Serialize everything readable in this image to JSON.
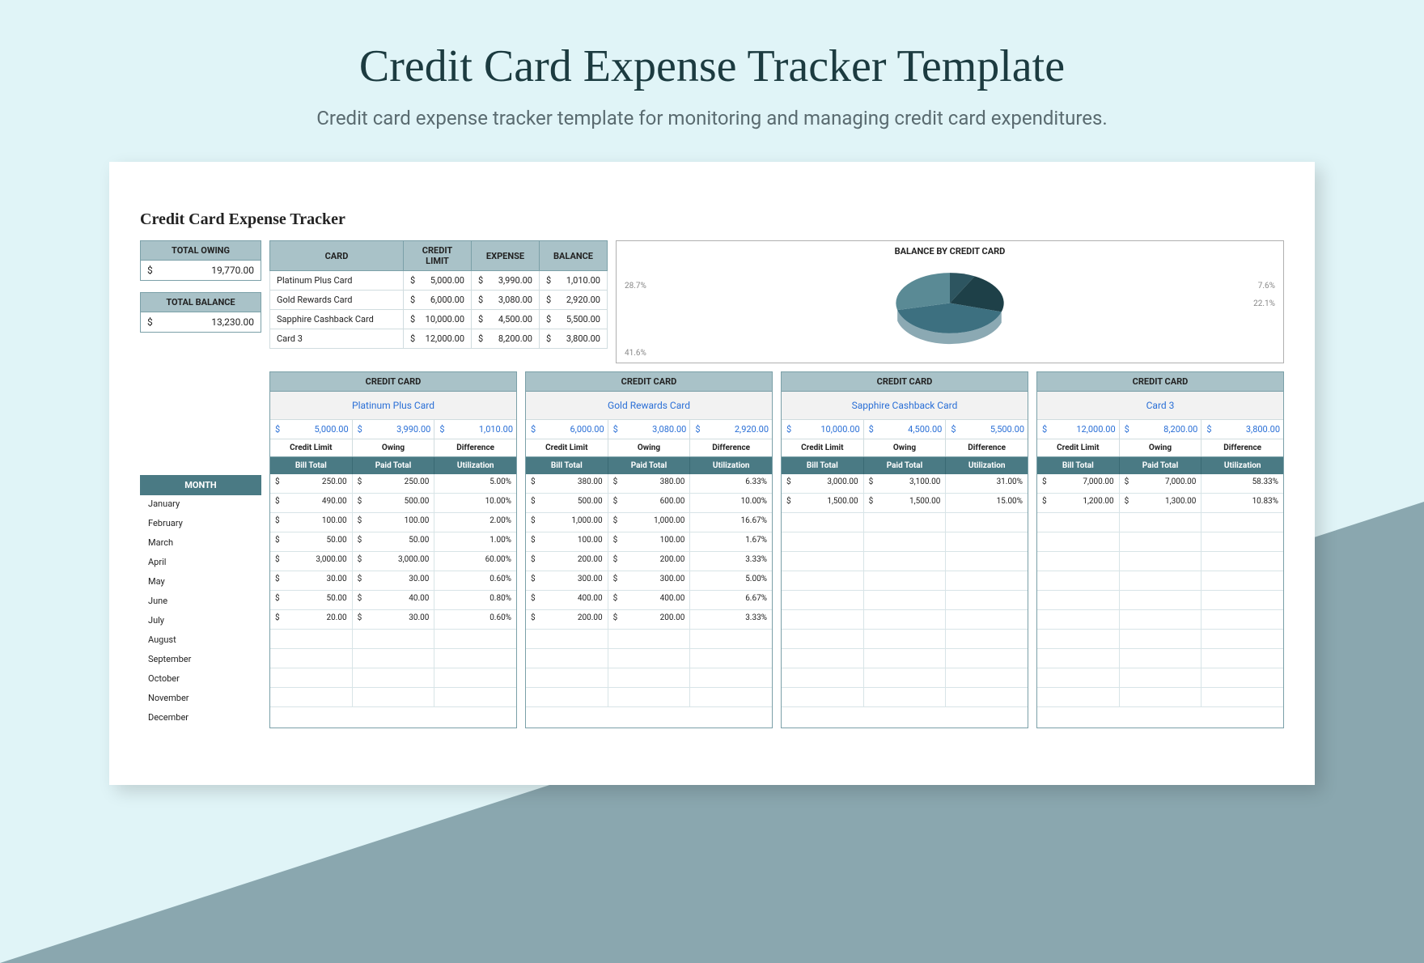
{
  "page": {
    "title": "Credit Card Expense Tracker Template",
    "subtitle": "Credit card expense tracker template for monitoring and managing credit card expenditures."
  },
  "sheet": {
    "title": "Credit Card Expense Tracker",
    "totals": {
      "owing_label": "TOTAL OWING",
      "owing_value": "19,770.00",
      "balance_label": "TOTAL BALANCE",
      "balance_value": "13,230.00"
    },
    "summary": {
      "headers": {
        "card": "CARD",
        "limit": "CREDIT LIMIT",
        "expense": "EXPENSE",
        "balance": "BALANCE"
      },
      "rows": [
        {
          "name": "Platinum Plus Card",
          "limit": "5,000.00",
          "expense": "3,990.00",
          "balance": "1,010.00"
        },
        {
          "name": "Gold Rewards Card",
          "limit": "6,000.00",
          "expense": "3,080.00",
          "balance": "2,920.00"
        },
        {
          "name": "Sapphire Cashback Card",
          "limit": "10,000.00",
          "expense": "4,500.00",
          "balance": "5,500.00"
        },
        {
          "name": "Card 3",
          "limit": "12,000.00",
          "expense": "8,200.00",
          "balance": "3,800.00"
        }
      ]
    },
    "chart_title": "BALANCE BY CREDIT CARD",
    "month_label": "MONTH",
    "months": [
      "January",
      "February",
      "March",
      "April",
      "May",
      "June",
      "July",
      "August",
      "September",
      "October",
      "November",
      "December"
    ],
    "card_header": "CREDIT CARD",
    "sublabels": {
      "limit": "Credit Limit",
      "owing": "Owing",
      "diff": "Difference"
    },
    "monthly_headers": {
      "bill": "Bill Total",
      "paid": "Paid Total",
      "util": "Utilization"
    },
    "cards": [
      {
        "name": "Platinum Plus Card",
        "limit": "5,000.00",
        "owing": "3,990.00",
        "diff": "1,010.00",
        "rows": [
          {
            "bill": "250.00",
            "paid": "250.00",
            "util": "5.00%"
          },
          {
            "bill": "490.00",
            "paid": "500.00",
            "util": "10.00%"
          },
          {
            "bill": "100.00",
            "paid": "100.00",
            "util": "2.00%"
          },
          {
            "bill": "50.00",
            "paid": "50.00",
            "util": "1.00%"
          },
          {
            "bill": "3,000.00",
            "paid": "3,000.00",
            "util": "60.00%"
          },
          {
            "bill": "30.00",
            "paid": "30.00",
            "util": "0.60%"
          },
          {
            "bill": "50.00",
            "paid": "40.00",
            "util": "0.80%"
          },
          {
            "bill": "20.00",
            "paid": "30.00",
            "util": "0.60%"
          },
          {},
          {},
          {},
          {}
        ]
      },
      {
        "name": "Gold Rewards Card",
        "limit": "6,000.00",
        "owing": "3,080.00",
        "diff": "2,920.00",
        "rows": [
          {
            "bill": "380.00",
            "paid": "380.00",
            "util": "6.33%"
          },
          {
            "bill": "500.00",
            "paid": "600.00",
            "util": "10.00%"
          },
          {
            "bill": "1,000.00",
            "paid": "1,000.00",
            "util": "16.67%"
          },
          {
            "bill": "100.00",
            "paid": "100.00",
            "util": "1.67%"
          },
          {
            "bill": "200.00",
            "paid": "200.00",
            "util": "3.33%"
          },
          {
            "bill": "300.00",
            "paid": "300.00",
            "util": "5.00%"
          },
          {
            "bill": "400.00",
            "paid": "400.00",
            "util": "6.67%"
          },
          {
            "bill": "200.00",
            "paid": "200.00",
            "util": "3.33%"
          },
          {},
          {},
          {},
          {}
        ]
      },
      {
        "name": "Sapphire Cashback Card",
        "limit": "10,000.00",
        "owing": "4,500.00",
        "diff": "5,500.00",
        "rows": [
          {
            "bill": "3,000.00",
            "paid": "3,100.00",
            "util": "31.00%"
          },
          {
            "bill": "1,500.00",
            "paid": "1,500.00",
            "util": "15.00%"
          },
          {},
          {},
          {},
          {},
          {},
          {},
          {},
          {},
          {},
          {}
        ]
      },
      {
        "name": "Card 3",
        "limit": "12,000.00",
        "owing": "8,200.00",
        "diff": "3,800.00",
        "rows": [
          {
            "bill": "7,000.00",
            "paid": "7,000.00",
            "util": "58.33%"
          },
          {
            "bill": "1,200.00",
            "paid": "1,300.00",
            "util": "10.83%"
          },
          {},
          {},
          {},
          {},
          {},
          {},
          {},
          {},
          {},
          {}
        ]
      }
    ]
  },
  "chart_data": {
    "type": "pie",
    "title": "BALANCE BY CREDIT CARD",
    "categories": [
      "Platinum Plus Card",
      "Gold Rewards Card",
      "Sapphire Cashback Card",
      "Card 3"
    ],
    "values": [
      1010,
      2920,
      5500,
      3800
    ],
    "percentages": [
      "7.6%",
      "22.1%",
      "41.6%",
      "28.7%"
    ],
    "colors": [
      "#2d5560",
      "#1e4048",
      "#3d7080",
      "#5a8a95"
    ]
  }
}
